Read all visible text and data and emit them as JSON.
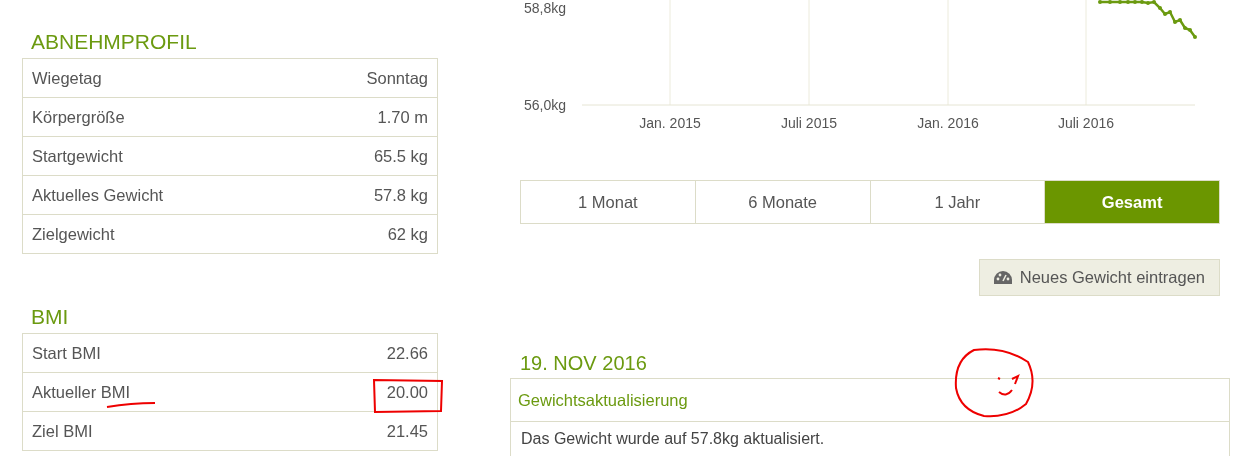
{
  "profile": {
    "title": "ABNEHMPROFIL",
    "rows": [
      {
        "label": "Wiegetag",
        "value": "Sonntag"
      },
      {
        "label": "Körpergröße",
        "value": "1.70 m"
      },
      {
        "label": "Startgewicht",
        "value": "65.5 kg"
      },
      {
        "label": "Aktuelles Gewicht",
        "value": "57.8 kg"
      },
      {
        "label": "Zielgewicht",
        "value": "62 kg"
      }
    ]
  },
  "bmi": {
    "title": "BMI",
    "rows": [
      {
        "label": "Start BMI",
        "value": "22.66"
      },
      {
        "label": "Aktueller BMI",
        "value": "20.00"
      },
      {
        "label": "Ziel BMI",
        "value": "21.45"
      }
    ]
  },
  "chart": {
    "y_labels": [
      "58,8kg",
      "56,0kg"
    ],
    "x_labels": [
      "Jan. 2015",
      "Juli 2015",
      "Jan. 2016",
      "Juli 2016"
    ]
  },
  "periods": [
    {
      "label": "1 Monat",
      "selected": false
    },
    {
      "label": "6 Monate",
      "selected": false
    },
    {
      "label": "1 Jahr",
      "selected": false
    },
    {
      "label": "Gesamt",
      "selected": true
    }
  ],
  "add_button": "Neues Gewicht eintragen",
  "entry": {
    "date": "19. NOV 2016",
    "title": "Gewichtsaktualisierung",
    "text": "Das Gewicht wurde auf 57.8kg aktualisiert."
  },
  "annotations": [
    {
      "kind": "underline"
    },
    {
      "kind": "box"
    },
    {
      "kind": "smiley"
    }
  ]
}
